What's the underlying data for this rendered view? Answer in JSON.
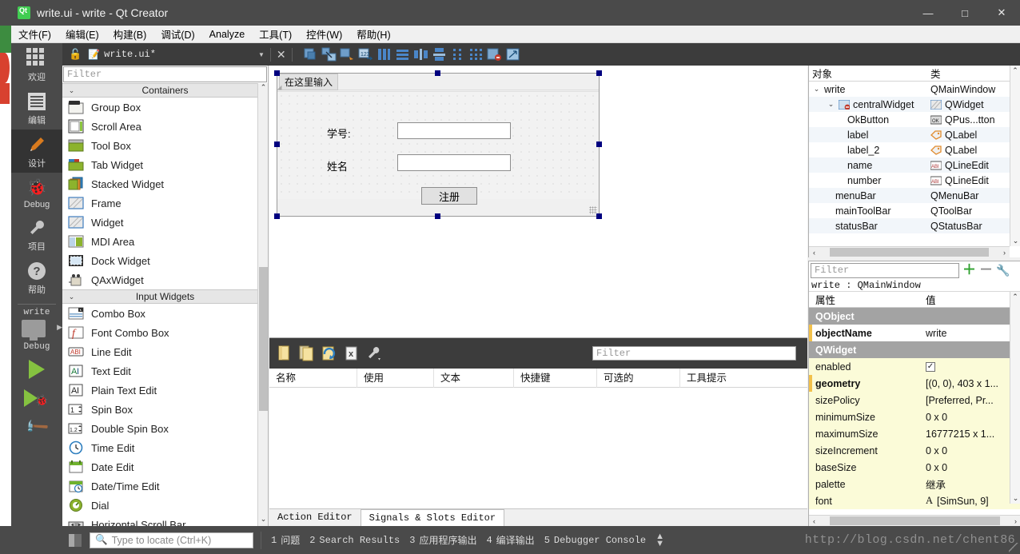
{
  "window": {
    "title": "write.ui - write - Qt Creator",
    "logo": "qt-logo",
    "minimize": "—",
    "maximize": "□",
    "close": "✕"
  },
  "menubar": {
    "items": [
      {
        "label": "文件(F)"
      },
      {
        "label": "编辑(E)"
      },
      {
        "label": "构建(B)"
      },
      {
        "label": "调试(D)"
      },
      {
        "label": "Analyze"
      },
      {
        "label": "工具(T)"
      },
      {
        "label": "控件(W)"
      },
      {
        "label": "帮助(H)"
      }
    ]
  },
  "modebar": {
    "modes": [
      {
        "label": "欢迎",
        "icon": "grid-icon"
      },
      {
        "label": "编辑",
        "icon": "document-icon"
      },
      {
        "label": "设计",
        "icon": "pencil-icon",
        "active": true
      },
      {
        "label": "Debug",
        "icon": "bug-icon"
      },
      {
        "label": "项目",
        "icon": "wrench-icon"
      },
      {
        "label": "帮助",
        "icon": "question-icon"
      }
    ],
    "kit_name": "write",
    "kit_config": "Debug",
    "run_icon": "run-triangle-icon",
    "debug_icon": "debug-run-icon",
    "build_icon": "hammer-icon"
  },
  "editbar": {
    "lock_icon": "unlocked-padlock-icon",
    "file_icon": "file-pencil-icon",
    "file_name": "write.ui*",
    "dropdown_icon": "chevron-down-icon",
    "close_icon": "close-x-icon",
    "tools": [
      {
        "name": "edit-widgets-icon"
      },
      {
        "name": "edit-signals-slots-icon"
      },
      {
        "name": "edit-buddies-icon"
      },
      {
        "name": "edit-tab-order-icon"
      },
      {
        "name": "layout-horizontally-icon"
      },
      {
        "name": "layout-vertically-icon"
      },
      {
        "name": "layout-splitter-horizontal-icon"
      },
      {
        "name": "layout-splitter-vertical-icon"
      },
      {
        "name": "layout-form-icon"
      },
      {
        "name": "layout-grid-icon"
      },
      {
        "name": "break-layout-icon"
      },
      {
        "name": "adjust-size-icon"
      }
    ]
  },
  "widgetbox": {
    "filter_placeholder": "Filter",
    "scroll_up_icon": "chevron-up-icon",
    "scroll_down_icon": "chevron-down-icon",
    "sections": [
      {
        "title": "Containers",
        "items": [
          {
            "label": "Group Box",
            "icon": "groupbox-icon"
          },
          {
            "label": "Scroll Area",
            "icon": "scrollarea-icon"
          },
          {
            "label": "Tool Box",
            "icon": "toolbox-icon"
          },
          {
            "label": "Tab Widget",
            "icon": "tabwidget-icon"
          },
          {
            "label": "Stacked Widget",
            "icon": "stackedwidget-icon"
          },
          {
            "label": "Frame",
            "icon": "frame-icon"
          },
          {
            "label": "Widget",
            "icon": "widget-icon"
          },
          {
            "label": "MDI Area",
            "icon": "mdiarea-icon"
          },
          {
            "label": "Dock Widget",
            "icon": "dockwidget-icon"
          },
          {
            "label": "QAxWidget",
            "icon": "qaxwidget-icon"
          }
        ]
      },
      {
        "title": "Input Widgets",
        "items": [
          {
            "label": "Combo Box",
            "icon": "combobox-icon"
          },
          {
            "label": "Font Combo Box",
            "icon": "fontcombobox-icon"
          },
          {
            "label": "Line Edit",
            "icon": "lineedit-icon"
          },
          {
            "label": "Text Edit",
            "icon": "textedit-icon"
          },
          {
            "label": "Plain Text Edit",
            "icon": "plaintextedit-icon"
          },
          {
            "label": "Spin Box",
            "icon": "spinbox-icon"
          },
          {
            "label": "Double Spin Box",
            "icon": "doublespinbox-icon"
          },
          {
            "label": "Time Edit",
            "icon": "timeedit-icon"
          },
          {
            "label": "Date Edit",
            "icon": "dateedit-icon"
          },
          {
            "label": "Date/Time Edit",
            "icon": "datetimeedit-icon"
          },
          {
            "label": "Dial",
            "icon": "dial-icon"
          },
          {
            "label": "Horizontal Scroll Bar",
            "icon": "hscrollbar-icon"
          }
        ]
      }
    ]
  },
  "form": {
    "menu_placeholder": "在这里输入",
    "label_number": "学号:",
    "label_name": "姓名",
    "button_register": "注册",
    "field_number_value": "",
    "field_name_value": ""
  },
  "action_editor": {
    "toolbar": [
      {
        "name": "new-action-icon"
      },
      {
        "name": "copy-action-icon"
      },
      {
        "name": "edit-action-icon"
      },
      {
        "name": "delete-action-icon"
      },
      {
        "name": "configure-icon"
      }
    ],
    "filter_placeholder": "Filter",
    "columns": [
      "名称",
      "使用",
      "文本",
      "快捷键",
      "可选的",
      "工具提示"
    ],
    "rows": [],
    "tabs": [
      {
        "label": "Action Editor",
        "active": false
      },
      {
        "label": "Signals & Slots Editor",
        "active": true
      }
    ]
  },
  "object_inspector": {
    "columns": [
      "对象",
      "类"
    ],
    "rows": [
      {
        "indent": 0,
        "expander": "⌄",
        "name": "write",
        "class": "QMainWindow",
        "icon": ""
      },
      {
        "indent": 1,
        "expander": "⌄",
        "name": "centralWidget",
        "class": "QWidget",
        "icon": "widget-icon"
      },
      {
        "indent": 2,
        "expander": "",
        "name": "OkButton",
        "class": "QPus...tton",
        "icon": "pushbutton-icon"
      },
      {
        "indent": 2,
        "expander": "",
        "name": "label",
        "class": "QLabel",
        "icon": "label-icon"
      },
      {
        "indent": 2,
        "expander": "",
        "name": "label_2",
        "class": "QLabel",
        "icon": "label-icon"
      },
      {
        "indent": 2,
        "expander": "",
        "name": "name",
        "class": "QLineEdit",
        "icon": "lineedit-icon"
      },
      {
        "indent": 2,
        "expander": "",
        "name": "number",
        "class": "QLineEdit",
        "icon": "lineedit-icon"
      },
      {
        "indent": 1,
        "expander": "",
        "name": "menuBar",
        "class": "QMenuBar",
        "icon": ""
      },
      {
        "indent": 1,
        "expander": "",
        "name": "mainToolBar",
        "class": "QToolBar",
        "icon": ""
      },
      {
        "indent": 1,
        "expander": "",
        "name": "statusBar",
        "class": "QStatusBar",
        "icon": ""
      }
    ]
  },
  "property_editor": {
    "filter_placeholder": "Filter",
    "add_icon": "plus-icon",
    "remove_icon": "minus-icon",
    "configure_icon": "wrench-icon",
    "object_header": "write : QMainWindow",
    "columns": [
      "属性",
      "值"
    ],
    "rows": [
      {
        "kind": "group",
        "key": "QObject",
        "value": ""
      },
      {
        "kind": "white",
        "key": "objectName",
        "value": "write",
        "bold": true,
        "marker": true
      },
      {
        "kind": "group",
        "key": "QWidget",
        "value": ""
      },
      {
        "kind": "yellow",
        "key": "enabled",
        "value": "",
        "checkbox": true
      },
      {
        "kind": "yellow",
        "key": "geometry",
        "value": "[(0, 0), 403 x 1...",
        "bold": true,
        "marker": true
      },
      {
        "kind": "yellow",
        "key": "sizePolicy",
        "value": "[Preferred, Pr..."
      },
      {
        "kind": "yellow",
        "key": "minimumSize",
        "value": "0 x 0"
      },
      {
        "kind": "yellow",
        "key": "maximumSize",
        "value": "16777215 x 1..."
      },
      {
        "kind": "yellow",
        "key": "sizeIncrement",
        "value": "0 x 0"
      },
      {
        "kind": "yellow",
        "key": "baseSize",
        "value": "0 x 0"
      },
      {
        "kind": "yellow",
        "key": "palette",
        "value": "继承"
      },
      {
        "kind": "yellow",
        "key": "font",
        "value": "[SimSun, 9]",
        "font_glyph": "A"
      }
    ]
  },
  "statusbar": {
    "sidebar_toggle_icon": "toggle-sidebar-icon",
    "locator_icon": "search-icon",
    "locator_placeholder": "Type to locate (Ctrl+K)",
    "panes": [
      {
        "num": "1",
        "label": "问题"
      },
      {
        "num": "2",
        "label": "Search Results"
      },
      {
        "num": "3",
        "label": "应用程序输出"
      },
      {
        "num": "4",
        "label": "编译输出"
      },
      {
        "num": "5",
        "label": "Debugger Console"
      }
    ],
    "updown_icon": "up-down-arrows-icon",
    "watermark": "http://blog.csdn.net/chent86"
  },
  "colors": {
    "titlebar": "#4a4a4a",
    "toolbar_dark": "#3c3c3c",
    "accent_green": "#41cd52",
    "selection_handle": "#00007f",
    "property_yellow": "#fbfbd8",
    "group_gray": "#a3a3a3"
  }
}
